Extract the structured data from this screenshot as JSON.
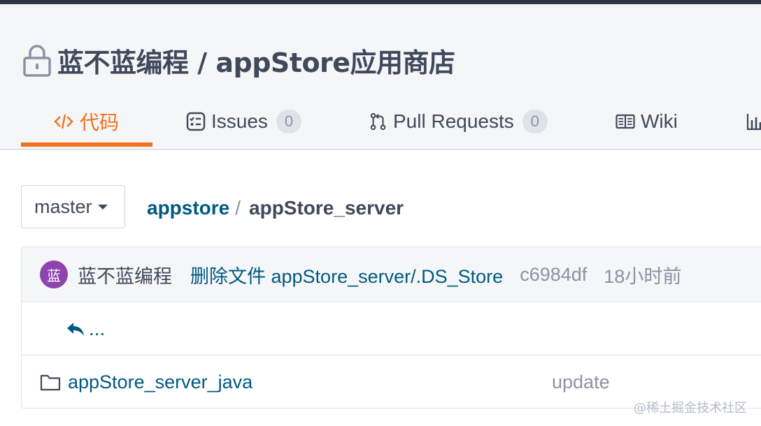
{
  "repo": {
    "owner": "蓝不蓝编程",
    "separator": " / ",
    "name": "appStore应用商店"
  },
  "tabs": [
    {
      "label": "代码",
      "icon": "code-icon",
      "active": true
    },
    {
      "label": "Issues",
      "count": "0",
      "icon": "issues-icon"
    },
    {
      "label": "Pull Requests",
      "count": "0",
      "icon": "pull-request-icon"
    },
    {
      "label": "Wiki",
      "icon": "wiki-icon"
    }
  ],
  "branch": {
    "label": "master"
  },
  "breadcrumb": {
    "root": "appstore",
    "sep": "/",
    "current": "appStore_server"
  },
  "commit": {
    "avatar_initial": "蓝",
    "avatar_color": "#8e44ad",
    "author": "蓝不蓝编程",
    "message": "删除文件 appStore_server/.DS_Store",
    "sha": "c6984df",
    "time": "18小时前"
  },
  "back": {
    "label": "..."
  },
  "files": [
    {
      "name": "appStore_server_java",
      "type": "folder",
      "message": "update"
    }
  ],
  "watermark": "@稀土掘金技术社区",
  "colors": {
    "accent": "#f2711c",
    "link": "#005980",
    "muted": "#8c92a4"
  }
}
